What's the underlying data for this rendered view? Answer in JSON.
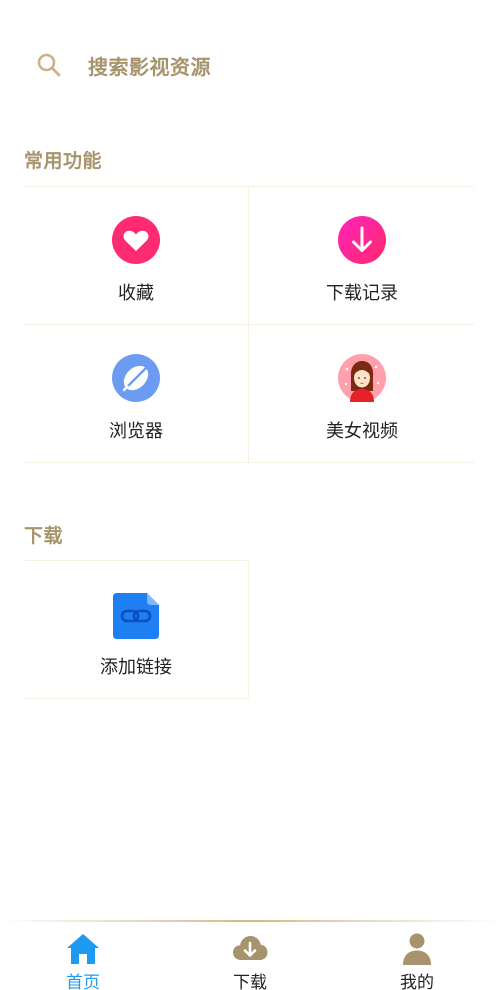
{
  "search": {
    "placeholder": "搜索影视资源",
    "icon": "search-icon"
  },
  "sections": {
    "common": {
      "title": "常用功能",
      "items": [
        {
          "label": "收藏",
          "icon": "heart-icon",
          "color": "#ff2a74"
        },
        {
          "label": "下载记录",
          "icon": "download-arrow-icon",
          "color": "#ff1f9e"
        },
        {
          "label": "浏览器",
          "icon": "browser-leaf-icon",
          "color": "#6c9cf2"
        },
        {
          "label": "美女视频",
          "icon": "girl-avatar-icon",
          "color": "#ff8fa1"
        }
      ]
    },
    "download": {
      "title": "下载",
      "items": [
        {
          "label": "添加链接",
          "icon": "link-file-icon",
          "color": "#1d7ff2"
        }
      ]
    }
  },
  "bottom_nav": {
    "tabs": [
      {
        "label": "首页",
        "icon": "home-icon",
        "active": true,
        "color": "#1e9bf0"
      },
      {
        "label": "下载",
        "icon": "cloud-download-icon",
        "active": false,
        "color": "#a8946c"
      },
      {
        "label": "我的",
        "icon": "user-icon",
        "active": false,
        "color": "#a8946c"
      }
    ]
  }
}
